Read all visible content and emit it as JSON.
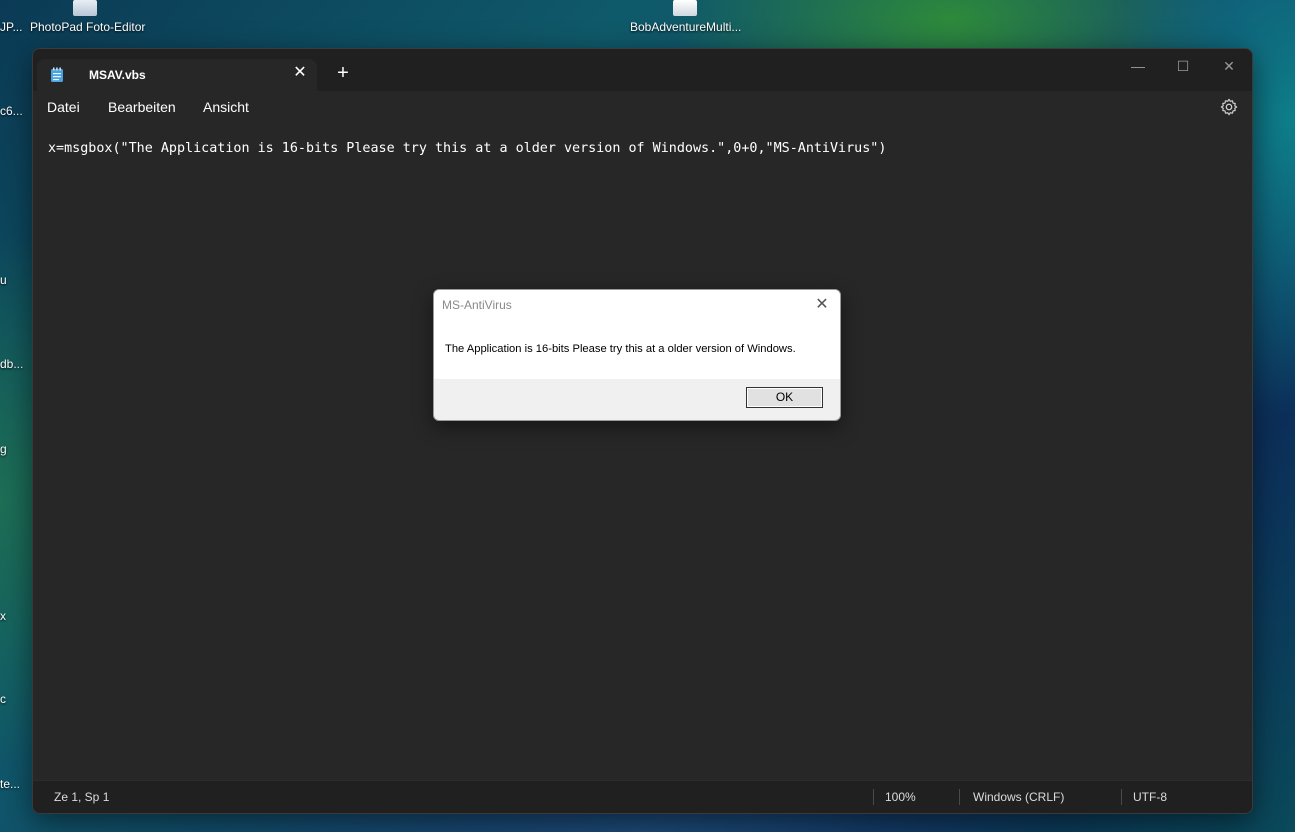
{
  "desktop": {
    "icons": [
      {
        "label": "PhotoPad Foto-Editor"
      },
      {
        "label": "BobAdventureMulti..."
      }
    ],
    "edge_labels": [
      "JP...",
      "c6...",
      "u",
      "db...",
      "g",
      "x",
      "c",
      "te..."
    ]
  },
  "notepad": {
    "tab_title": "MSAV.vbs",
    "tab_close_glyph": "✕",
    "new_tab_glyph": "+",
    "window_controls": {
      "minimize": "—",
      "maximize": "☐",
      "close": "✕"
    },
    "menu": {
      "file": "Datei",
      "edit": "Bearbeiten",
      "view": "Ansicht"
    },
    "content": "x=msgbox(\"The Application is 16-bits Please try this at a older version of Windows.\",0+0,\"MS-AntiVirus\")",
    "status": {
      "position": "Ze 1, Sp 1",
      "zoom": "100%",
      "line_ending": "Windows (CRLF)",
      "encoding": "UTF-8"
    }
  },
  "msgbox": {
    "title": "MS-AntiVirus",
    "close_glyph": "✕",
    "message": "The Application is 16-bits Please try this at a older version of Windows.",
    "ok_label": "OK"
  },
  "colors": {
    "window_bg": "#272727",
    "titlebar_bg": "#202020",
    "dialog_bg": "#f0f0f0"
  }
}
